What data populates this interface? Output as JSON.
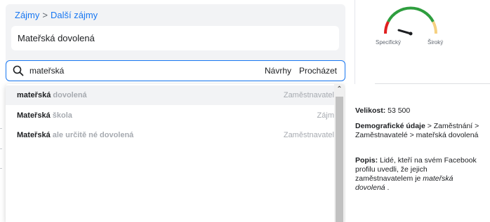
{
  "breadcrumb": {
    "part1": "Zájmy",
    "separator": ">",
    "part2": "Další zájmy"
  },
  "selected_interest": "Mateřská dovolená",
  "search": {
    "value": "mateřská",
    "suggestions_label": "Návrhy",
    "browse_label": "Procházet"
  },
  "dropdown": {
    "items": [
      {
        "bold": "mateřská",
        "rest": " dovolená",
        "category": "Zaměstnavatel"
      },
      {
        "bold": "Mateřská",
        "rest": " škola",
        "category": "Zájm"
      },
      {
        "bold": "Mateřská",
        "rest": " ale určitě né dovolená",
        "category": "Zaměstnavatel"
      }
    ]
  },
  "info": {
    "size_label": "Velikost:",
    "size_value": "53 500",
    "demo_label": "Demografické údaje",
    "demo_text": " > Zaměstnání > Zaměstnavatelé > mateřská dovolená",
    "desc_label": "Popis:",
    "desc_text": " Lidé, kteří na svém Facebook profilu uvedli, že jejich zaměstnavatelem je ",
    "desc_em": "mateřská dovolená",
    "desc_end": " ."
  },
  "gauge": {
    "left_label": "Specifický",
    "right_label": "Široký",
    "level": 0.22,
    "colors": {
      "red": "#e02020",
      "green": "#2e9e3e",
      "yellow": "#f5d080",
      "needle": "#1c1e21"
    }
  },
  "colors": {
    "accent": "#1877f2",
    "panel_bg": "#f2f3f5",
    "muted_text": "#a6aab0"
  },
  "icons": {
    "search": "search-icon",
    "scroll_up": "chevron-up-icon"
  }
}
